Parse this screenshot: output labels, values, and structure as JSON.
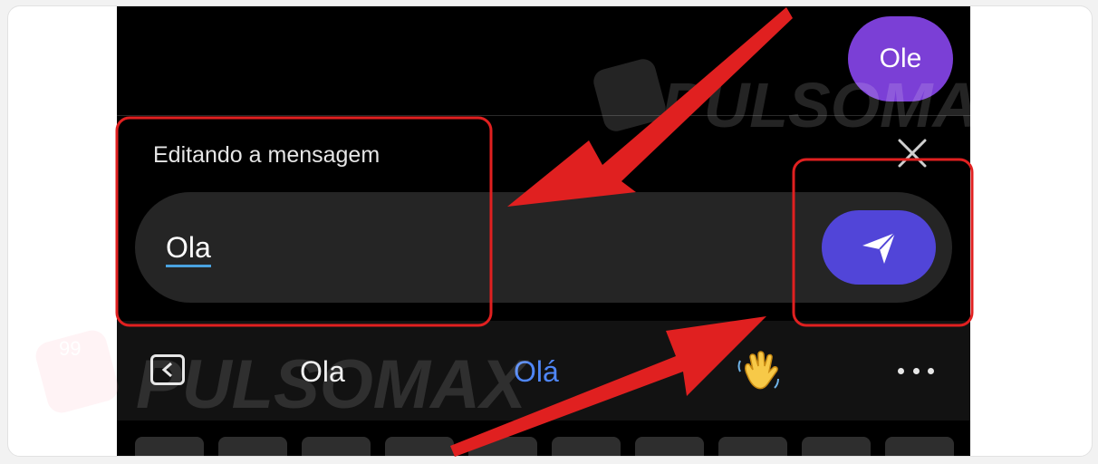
{
  "chat": {
    "last_bubble_text": "Ole"
  },
  "edit_panel": {
    "title": "Editando a mensagem",
    "input_value": "Ola",
    "close_icon": "close-icon",
    "send_icon": "send-icon"
  },
  "keyboard": {
    "suggestions": [
      "Ola",
      "Olá"
    ],
    "emoji_suggestion": "waving-hand",
    "back_icon": "chevron-left-icon",
    "more_icon": "more-horizontal-icon"
  },
  "watermark": {
    "text": "PULSOMAX",
    "badge_text": "99"
  },
  "colors": {
    "background": "#000000",
    "bubble": "#7b3fd6",
    "send_button": "#5145d8",
    "suggestion_accent": "#4f86f7",
    "annotation_red": "#e02020"
  }
}
